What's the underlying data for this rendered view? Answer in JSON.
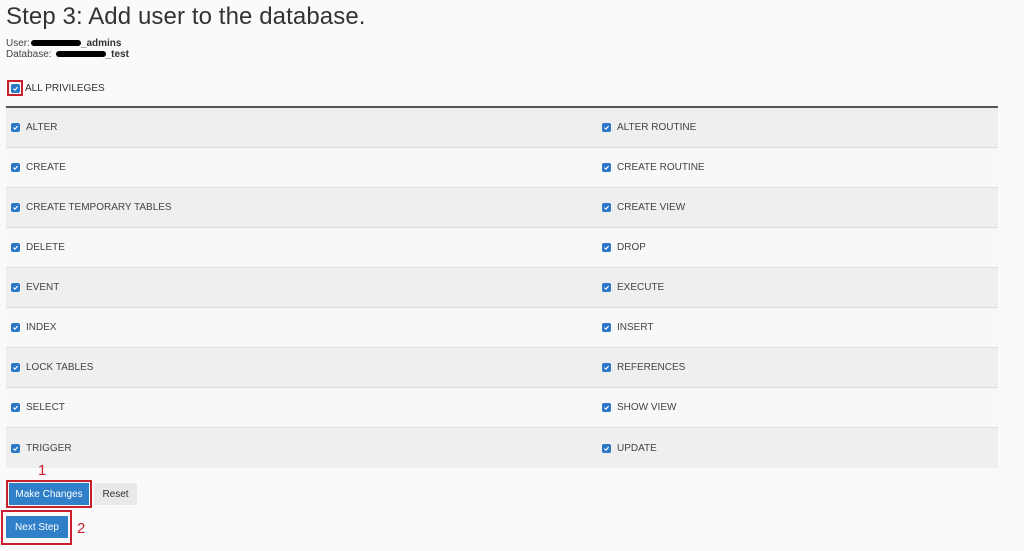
{
  "page": {
    "title": "Step 3: Add user to the database.",
    "user_label": "User:",
    "user_value_visible": "_admins",
    "database_label": "Database:",
    "database_value_visible": "_test"
  },
  "all_privileges": {
    "label": "ALL PRIVILEGES",
    "checked": true
  },
  "privileges": [
    {
      "left": "ALTER",
      "right": "ALTER ROUTINE"
    },
    {
      "left": "CREATE",
      "right": "CREATE ROUTINE"
    },
    {
      "left": "CREATE TEMPORARY TABLES",
      "right": "CREATE VIEW"
    },
    {
      "left": "DELETE",
      "right": "DROP"
    },
    {
      "left": "EVENT",
      "right": "EXECUTE"
    },
    {
      "left": "INDEX",
      "right": "INSERT"
    },
    {
      "left": "LOCK TABLES",
      "right": "REFERENCES"
    },
    {
      "left": "SELECT",
      "right": "SHOW VIEW"
    },
    {
      "left": "TRIGGER",
      "right": "UPDATE"
    }
  ],
  "buttons": {
    "make_changes": "Make Changes",
    "reset": "Reset",
    "next_step": "Next Step"
  },
  "annotations": {
    "first": "1",
    "second": "2"
  },
  "colors": {
    "accent": "#2f7fc9",
    "highlight": "#c8202f",
    "checkbox": "#2a78c6"
  }
}
